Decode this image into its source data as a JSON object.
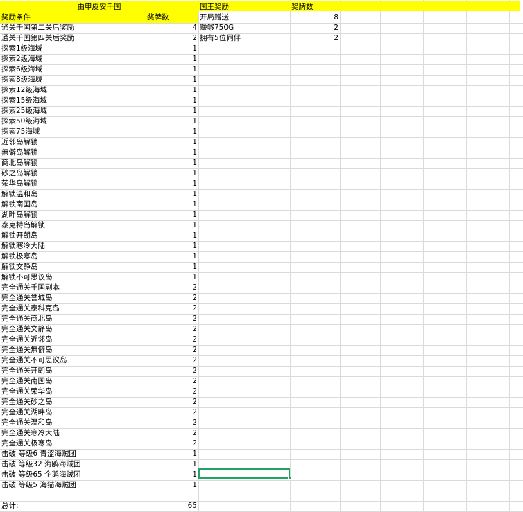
{
  "left_table": {
    "title": "由甲皮安千国",
    "header": {
      "condition": "奖励条件",
      "count": "奖牌数"
    },
    "rows": [
      {
        "condition": "通关千国第二关后奖励",
        "count": "4"
      },
      {
        "condition": "通关千国第四关后奖励",
        "count": "2"
      },
      {
        "condition": "探索1级海域",
        "count": "1"
      },
      {
        "condition": "探索2级海域",
        "count": "1"
      },
      {
        "condition": "探索6级海域",
        "count": "1"
      },
      {
        "condition": "探索8级海域",
        "count": "1"
      },
      {
        "condition": "探索12级海域",
        "count": "1"
      },
      {
        "condition": "探索15级海域",
        "count": "1"
      },
      {
        "condition": "探索25级海域",
        "count": "1"
      },
      {
        "condition": "探索50级海域",
        "count": "1"
      },
      {
        "condition": "探索75海域",
        "count": "1"
      },
      {
        "condition": "近邻岛解锁",
        "count": "1"
      },
      {
        "condition": "無僻岛解锁",
        "count": "1"
      },
      {
        "condition": "商北岛解锁",
        "count": "1"
      },
      {
        "condition": "砂之岛解锁",
        "count": "1"
      },
      {
        "condition": "荣华岛解锁",
        "count": "1"
      },
      {
        "condition": "解锁温和岛",
        "count": "1"
      },
      {
        "condition": "解锁南国岛",
        "count": "1"
      },
      {
        "condition": "湖畔岛解锁",
        "count": "1"
      },
      {
        "condition": "泰克特岛解锁",
        "count": "1"
      },
      {
        "condition": "解锁开朗岛",
        "count": "1"
      },
      {
        "condition": "解锁寒冷大陆",
        "count": "1"
      },
      {
        "condition": "解锁极寒岛",
        "count": "1"
      },
      {
        "condition": "解锁文静岛",
        "count": "1"
      },
      {
        "condition": "解锁不可思议岛",
        "count": "1"
      },
      {
        "condition": "完全通关千国副本",
        "count": "2"
      },
      {
        "condition": "完全通关誉城岛",
        "count": "2"
      },
      {
        "condition": "完全通关泰科克岛",
        "count": "2"
      },
      {
        "condition": "完全通关商北岛",
        "count": "2"
      },
      {
        "condition": "完全通关文静岛",
        "count": "2"
      },
      {
        "condition": "完全通关近邻岛",
        "count": "2"
      },
      {
        "condition": "完全通关無僻岛",
        "count": "2"
      },
      {
        "condition": "完全通关不可思议岛",
        "count": "2"
      },
      {
        "condition": "完全通关开朗岛",
        "count": "2"
      },
      {
        "condition": "完全通关南国岛",
        "count": "2"
      },
      {
        "condition": "完全通关荣华岛",
        "count": "2"
      },
      {
        "condition": "完全通关砂之岛",
        "count": "2"
      },
      {
        "condition": "完全通关湖畔岛",
        "count": "2"
      },
      {
        "condition": "完全通关温和岛",
        "count": "2"
      },
      {
        "condition": "完全通关寒冷大陆",
        "count": "2"
      },
      {
        "condition": "完全通关极寒岛",
        "count": "2"
      },
      {
        "condition": "击破 等级6 青涩海贼团",
        "count": "1"
      },
      {
        "condition": "击破 等级32 海鸥海贼团",
        "count": "1"
      },
      {
        "condition": "击破 等级65 企鹅海贼团",
        "count": "1"
      },
      {
        "condition": "击破 等级5 海猫海贼团",
        "count": "1"
      }
    ],
    "total_label": "总计:",
    "total_value": "65"
  },
  "right_table": {
    "header": {
      "reward": "国王奖励",
      "count": "奖牌数"
    },
    "rows": [
      {
        "reward": "开局赠送",
        "count": "8"
      },
      {
        "reward": "赚够750G",
        "count": "2"
      },
      {
        "reward": "拥有5位同伴",
        "count": "2"
      }
    ]
  },
  "colors": {
    "header_fill": "#ffff00",
    "gridline": "#dadada",
    "selection_border": "#21a366"
  }
}
